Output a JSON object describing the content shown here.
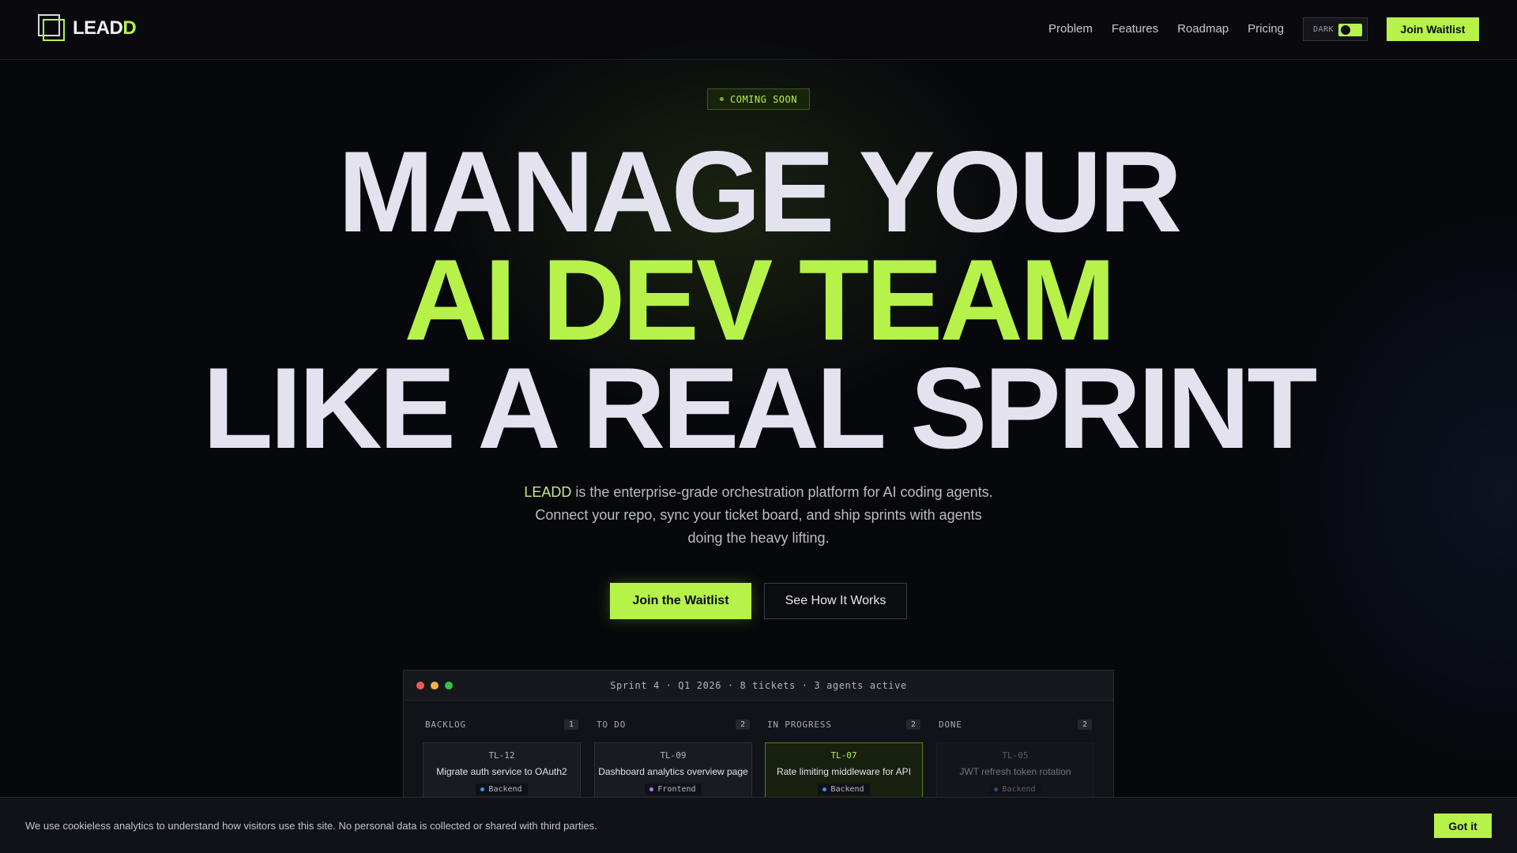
{
  "nav": {
    "logo_main": "LEAD",
    "logo_accent": "D",
    "links": [
      "Problem",
      "Features",
      "Roadmap",
      "Pricing"
    ],
    "theme_label": "DARK",
    "cta": "Join Waitlist"
  },
  "hero": {
    "badge": "COMING SOON",
    "line1": "MANAGE YOUR",
    "line2": "AI DEV TEAM",
    "line3": "LIKE A REAL SPRINT",
    "subtitle_brand": "LEADD",
    "subtitle_rest": " is the enterprise-grade orchestration platform for AI coding agents. Connect your repo, sync your ticket board, and ship sprints with agents doing the heavy lifting.",
    "primary_cta": "Join the Waitlist",
    "secondary_cta": "See How It Works"
  },
  "board": {
    "title": "Sprint 4 · Q1 2026 · 8 tickets · 3 agents active",
    "columns": [
      {
        "name": "BACKLOG",
        "count": "1",
        "card": {
          "id": "TL-12",
          "title": "Migrate auth service to OAuth2",
          "tag": "Backend",
          "tag_color": "#4a8cf0"
        }
      },
      {
        "name": "TO DO",
        "count": "2",
        "card": {
          "id": "TL-09",
          "title": "Dashboard analytics overview page",
          "tag": "Frontend",
          "tag_color": "#b07cf0"
        }
      },
      {
        "name": "IN PROGRESS",
        "count": "2",
        "card": {
          "id": "TL-07",
          "title": "Rate limiting middleware for API",
          "tag": "Backend",
          "tag_color": "#4a8cf0"
        }
      },
      {
        "name": "DONE",
        "count": "2",
        "card": {
          "id": "TL-05",
          "title": "JWT refresh token rotation",
          "tag": "Backend",
          "tag_color": "#4a8cf0"
        }
      }
    ]
  },
  "cookie": {
    "text": "We use cookieless analytics to understand how visitors use this site. No personal data is collected or shared with third parties.",
    "button": "Got it"
  },
  "colors": {
    "accent": "#b6f24a",
    "background": "#07080c"
  }
}
